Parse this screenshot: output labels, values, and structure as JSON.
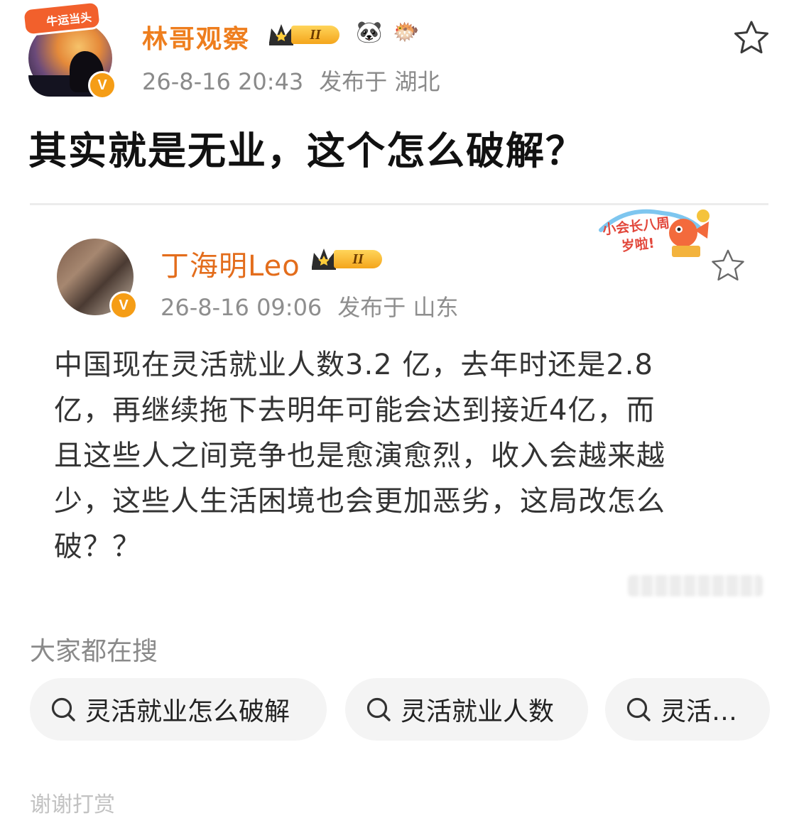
{
  "post": {
    "username": "林哥观察",
    "avatar_badge": "牛运当头",
    "verified_mark": "V",
    "level_badge": "II",
    "date": "26-8-16 20:43",
    "location": "发布于 湖北",
    "title": "其实就是无业，这个怎么破解？"
  },
  "quoted": {
    "username": "丁海明Leo",
    "verified_mark": "V",
    "level_badge": "II",
    "date": "26-8-16 09:06",
    "location": "发布于 山东",
    "promo": "小会长八周岁啦!",
    "body_lines": [
      "中国现在灵活就业人数3.2 亿，去年时还是2.8",
      "亿，再继续拖下去明年可能会达到接近4亿，而",
      "且这些人之间竞争也是愈演愈烈，收入会越来越",
      "少，这些人生活困境也会更加恶劣，这局改怎么",
      "破？？"
    ]
  },
  "hot_search": {
    "title": "大家都在搜",
    "chips": [
      "灵活就业怎么破解",
      "灵活就业人数",
      "灵活…"
    ]
  },
  "cut_off_text": "谢谢打赏",
  "colors": {
    "username_orange": "#ee7e1e",
    "meta_gray": "#8a8a8a",
    "chip_bg": "#f4f4f4",
    "verified_orange": "#f59d16"
  }
}
